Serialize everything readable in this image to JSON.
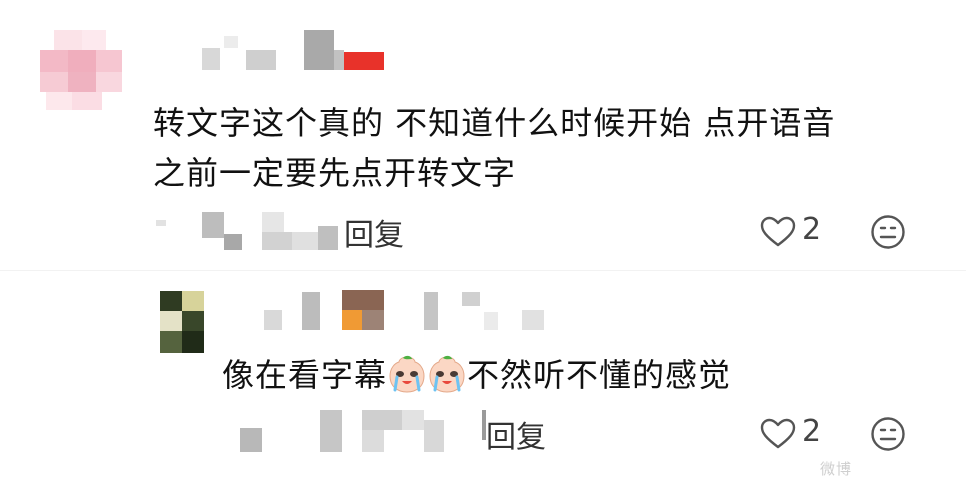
{
  "comments": [
    {
      "text_line1": "转文字这个真的 不知道什么时候开始 点开语音",
      "text_line2": "之前一定要先点开转文字",
      "reply_label": "回复",
      "like_count": "2"
    },
    {
      "text_before": "像在看字幕",
      "text_after": "不然听不懂的感觉",
      "reply_label": "回复",
      "like_count": "2"
    }
  ],
  "icons": {
    "heart": "heart-outline-icon",
    "emoji": "emoji-face-icon",
    "crying": "crying-face-emoji-icon"
  },
  "colors": {
    "text": "#111111",
    "accent_red": "#e8322a",
    "blur_gray": "#c9c9c9"
  },
  "watermark": "微博"
}
